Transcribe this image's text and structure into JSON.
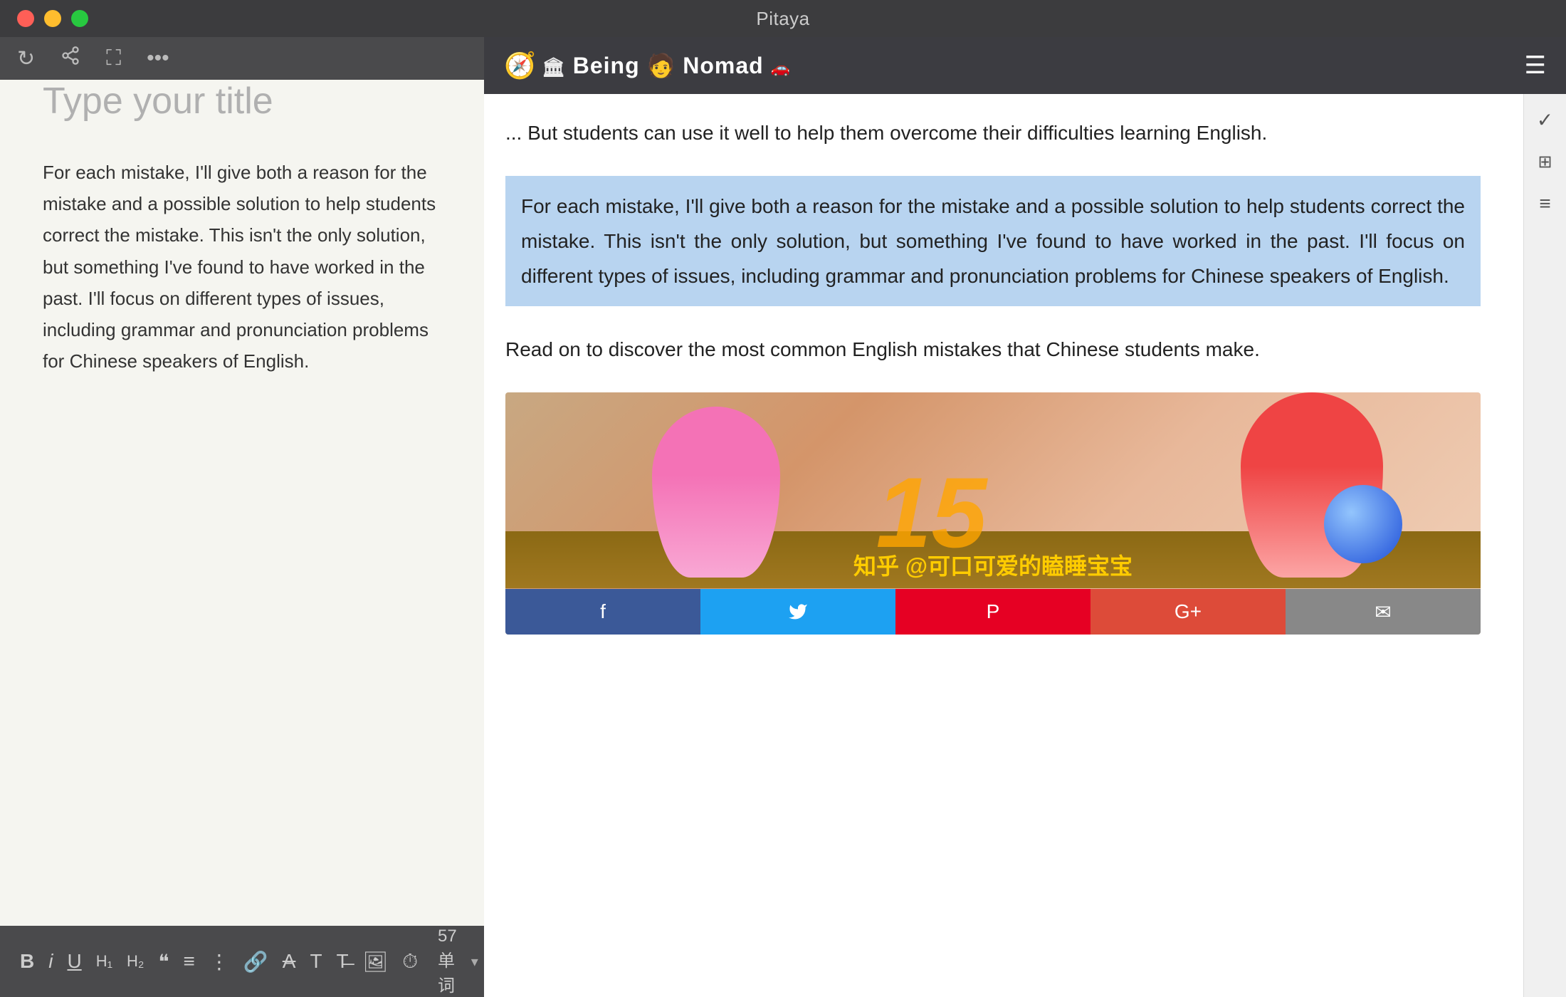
{
  "window": {
    "title": "Pitaya"
  },
  "traffic_lights": [
    "red",
    "yellow",
    "green"
  ],
  "toolbar": {
    "icons": [
      "refresh",
      "share",
      "expand",
      "more"
    ]
  },
  "editor": {
    "title_placeholder": "Type your title",
    "body_text": "For each mistake, I'll give both a reason for the mistake and a possible solution to help students correct the mistake. This isn't the only solution, but something I've found to have worked in the past. I'll focus on different types of issues, including grammar and pronunciation problems for Chinese speakers of English."
  },
  "format_bar": {
    "word_count_label": "57 单词",
    "icons": [
      "B",
      "i",
      "U",
      "H1",
      "H2",
      "quote",
      "list-ul",
      "list-ol",
      "link",
      "strikethrough",
      "T",
      "remove-format",
      "image",
      "clock"
    ]
  },
  "web": {
    "nav": {
      "logo_icon": "🧭",
      "logo_text": "Being Nomad",
      "menu_icon": "☰"
    },
    "content": {
      "intro_text": "... But students can use it well to help them overcome their difficulties learning English.",
      "highlighted_text": "For each mistake, I'll give both a reason for the mistake and a possible solution to help students correct the mistake. This isn't the only solution, but something I've found to have worked in the past. I'll focus on different types of issues, including grammar and pronunciation problems for Chinese speakers of English.",
      "read_on_text": "Read on to discover the most common English mistakes that Chinese students make."
    },
    "social": {
      "buttons": [
        {
          "label": "f",
          "platform": "facebook"
        },
        {
          "label": "🐦",
          "platform": "twitter"
        },
        {
          "label": "P",
          "platform": "pinterest"
        },
        {
          "label": "G+",
          "platform": "gplus"
        },
        {
          "label": "✉",
          "platform": "email"
        }
      ]
    },
    "image": {
      "watermark": "知乎 @可口可爱的瞌睡宝宝",
      "number": "15"
    }
  },
  "right_sidebar": {
    "icons": [
      "✓",
      "⊞",
      "≡"
    ]
  }
}
